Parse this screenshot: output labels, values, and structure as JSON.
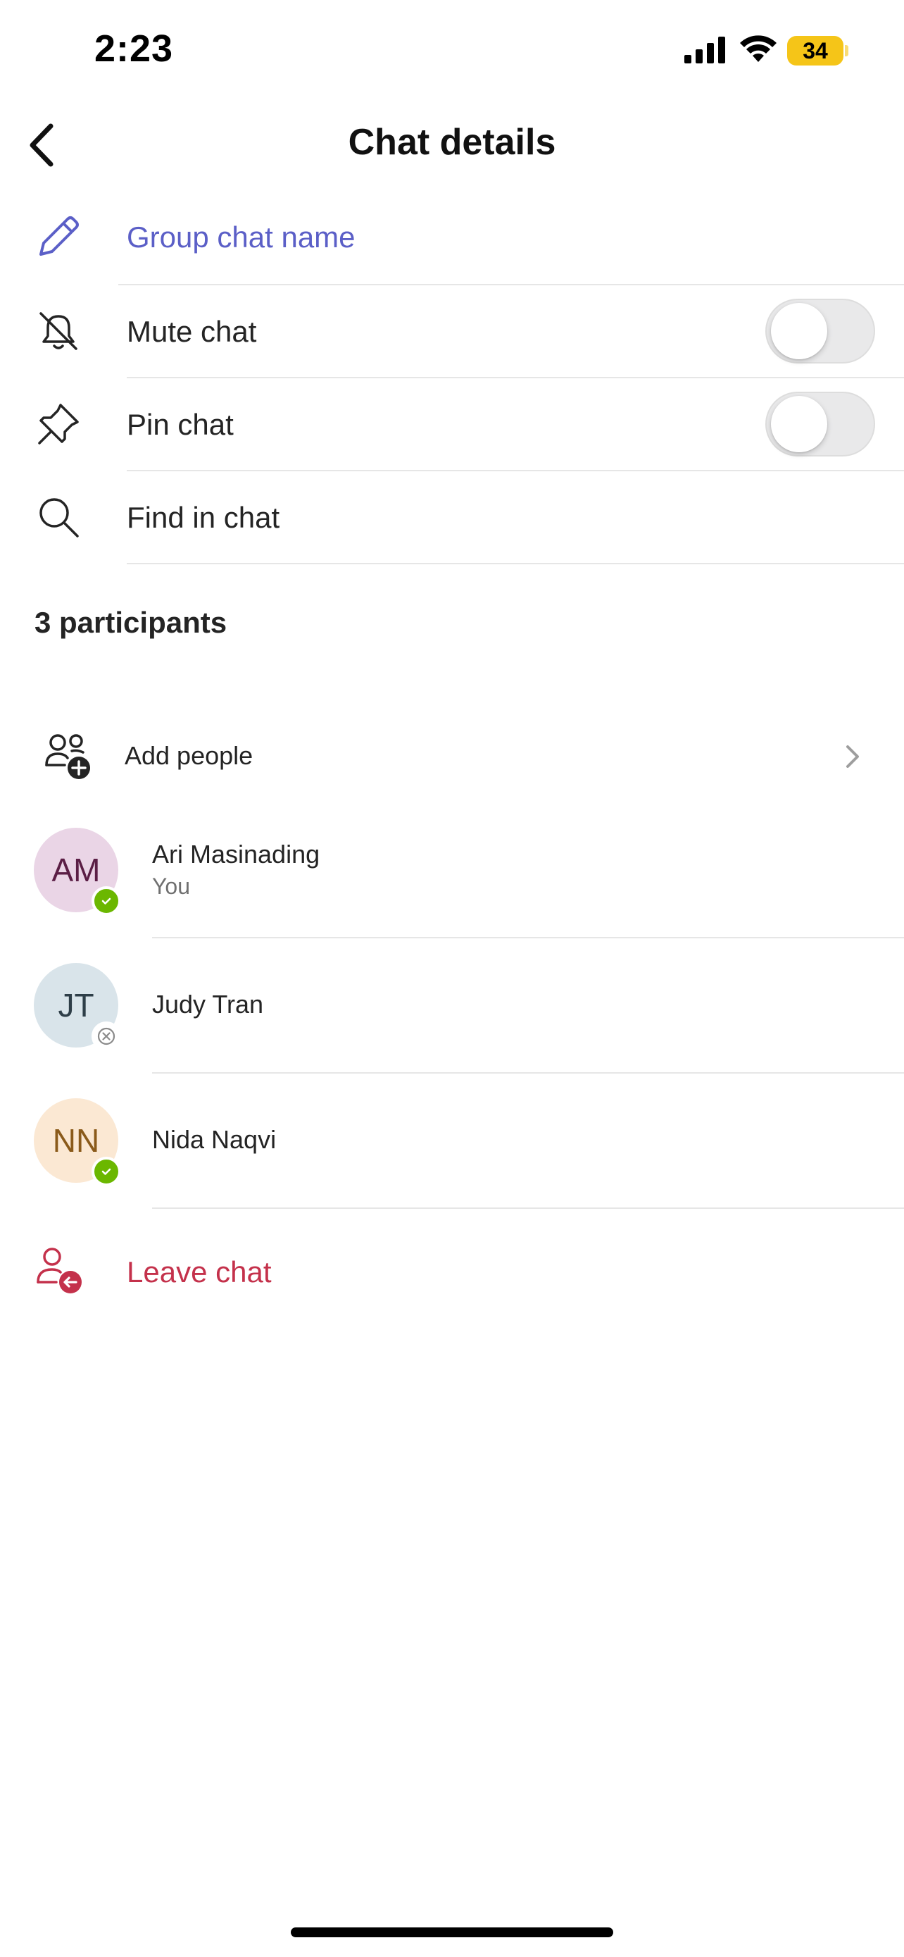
{
  "status_bar": {
    "time": "2:23",
    "battery": "34"
  },
  "header": {
    "title": "Chat details"
  },
  "settings": {
    "group_name_label": "Group chat name",
    "mute_label": "Mute chat",
    "mute_on": false,
    "pin_label": "Pin chat",
    "pin_on": false,
    "find_label": "Find in chat"
  },
  "participants": {
    "title": "3 participants",
    "add_label": "Add people",
    "list": [
      {
        "initials": "AM",
        "name": "Ari Masinading",
        "subtitle": "You",
        "presence": "available"
      },
      {
        "initials": "JT",
        "name": "Judy Tran",
        "subtitle": "",
        "presence": "offline"
      },
      {
        "initials": "NN",
        "name": "Nida Naqvi",
        "subtitle": "",
        "presence": "available"
      }
    ]
  },
  "leave": {
    "label": "Leave chat"
  },
  "colors": {
    "accent": "#5b5fc7",
    "danger": "#c4314b",
    "available": "#6bb700",
    "avatar_am_bg": "#ead5e6",
    "avatar_am_fg": "#5b1e45",
    "avatar_jt_bg": "#d9e4ea",
    "avatar_jt_fg": "#2e3e48",
    "avatar_nn_bg": "#fbe8d3",
    "avatar_nn_fg": "#8a5a1a"
  }
}
